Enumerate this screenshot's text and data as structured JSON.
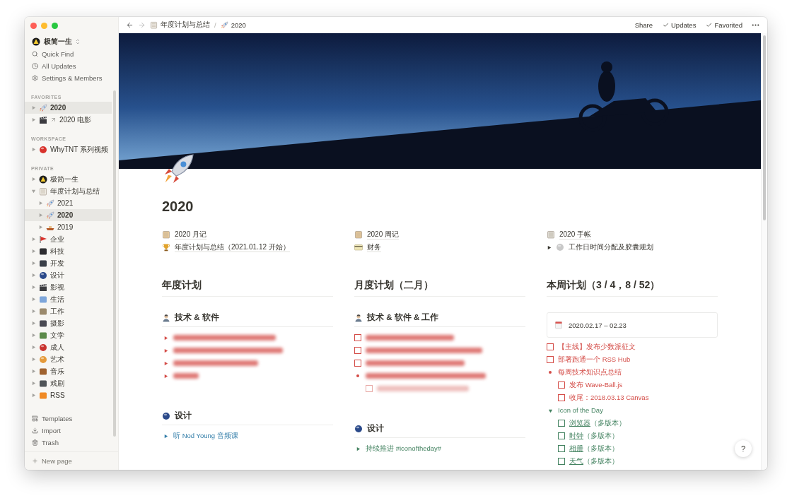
{
  "sidebar": {
    "workspace": "极简一生",
    "actions": [
      {
        "label": "Quick Find"
      },
      {
        "label": "All Updates"
      },
      {
        "label": "Settings & Members"
      }
    ],
    "sections": [
      {
        "title": "FAVORITES",
        "items": [
          {
            "label": "2020",
            "selected": true,
            "expanded": false
          },
          {
            "label": "2020 电影",
            "selected": false,
            "expanded": false,
            "link": true
          }
        ]
      },
      {
        "title": "WORKSPACE",
        "items": [
          {
            "label": "WhyTNT 系列视频",
            "selected": false,
            "expanded": false
          }
        ]
      },
      {
        "title": "PRIVATE",
        "items": [
          {
            "label": "极简一生",
            "selected": false,
            "expanded": false
          },
          {
            "label": "年度计划与总结",
            "selected": false,
            "expanded": true,
            "children": [
              {
                "label": "2021",
                "selected": false,
                "expanded": false
              },
              {
                "label": "2020",
                "selected": true,
                "expanded": false
              },
              {
                "label": "2019",
                "selected": false,
                "expanded": false
              }
            ]
          },
          {
            "label": "企业",
            "selected": false,
            "expanded": false
          },
          {
            "label": "科技",
            "selected": false,
            "expanded": false
          },
          {
            "label": "开发",
            "selected": false,
            "expanded": false
          },
          {
            "label": "设计",
            "selected": false,
            "expanded": false
          },
          {
            "label": "影视",
            "selected": false,
            "expanded": false
          },
          {
            "label": "生活",
            "selected": false,
            "expanded": false
          },
          {
            "label": "工作",
            "selected": false,
            "expanded": false
          },
          {
            "label": "摄影",
            "selected": false,
            "expanded": false
          },
          {
            "label": "文学",
            "selected": false,
            "expanded": false
          },
          {
            "label": "成人",
            "selected": false,
            "expanded": false
          },
          {
            "label": "艺术",
            "selected": false,
            "expanded": false
          },
          {
            "label": "音乐",
            "selected": false,
            "expanded": false
          },
          {
            "label": "戏剧",
            "selected": false,
            "expanded": false
          },
          {
            "label": "RSS",
            "selected": false,
            "expanded": false
          }
        ]
      }
    ],
    "footer": [
      {
        "label": "Templates"
      },
      {
        "label": "Import"
      },
      {
        "label": "Trash"
      }
    ],
    "new_page": "New page"
  },
  "topbar": {
    "breadcrumbs": [
      {
        "label": "年度计划与总结"
      },
      {
        "label": "2020"
      }
    ],
    "separator": "/",
    "actions": [
      {
        "label": "Share",
        "checked": false
      },
      {
        "label": "Updates",
        "checked": true
      },
      {
        "label": "Favorited",
        "checked": true
      }
    ]
  },
  "page": {
    "title": "2020",
    "links": [
      [
        {
          "kind": "page",
          "text": "2020 月记"
        },
        {
          "kind": "page",
          "text": "年度计划与总结（2021.01.12 开始）"
        }
      ],
      [
        {
          "kind": "page",
          "text": "2020 周记"
        },
        {
          "kind": "page",
          "text": "财务"
        }
      ],
      [
        {
          "kind": "page",
          "text": "2020 手帐"
        },
        {
          "kind": "toggle",
          "text": "工作日时间分配及胶囊规划",
          "expanded": false
        }
      ]
    ],
    "columns": [
      {
        "heading": "年度计划",
        "sections": [
          {
            "title": "技术 & 软件",
            "blocks": [
              {
                "kind": "toggle",
                "blurred": true,
                "expanded": false,
                "color": "#d44c47"
              },
              {
                "kind": "toggle",
                "blurred": true,
                "expanded": false,
                "color": "#d44c47"
              },
              {
                "kind": "toggle",
                "blurred": true,
                "expanded": false,
                "color": "#d44c47"
              },
              {
                "kind": "toggle",
                "blurred": true,
                "expanded": false,
                "color": "#d44c47"
              }
            ]
          },
          {
            "title": "设计",
            "blocks": [
              {
                "kind": "toggle",
                "text": "听 Nod Young 音频课",
                "expanded": false,
                "color": "#337ea9"
              }
            ]
          }
        ]
      },
      {
        "heading": "月度计划（二月）",
        "sections": [
          {
            "title": "技术 & 软件 & 工作",
            "blocks": [
              {
                "kind": "todo",
                "blurred": true,
                "checked": false,
                "color": "#d44c47"
              },
              {
                "kind": "todo",
                "blurred": true,
                "checked": false,
                "color": "#d44c47"
              },
              {
                "kind": "todo",
                "blurred": true,
                "checked": false,
                "color": "#d44c47"
              },
              {
                "kind": "bullet",
                "blurred": true,
                "color": "#d44c47",
                "children": [
                  {
                    "kind": "todo",
                    "blurred": true,
                    "checked": false,
                    "color": "#e8a9a6"
                  }
                ]
              }
            ]
          },
          {
            "title": "设计",
            "blocks": [
              {
                "kind": "toggle",
                "text": "持续推进 #iconoftheday#",
                "expanded": false,
                "color": "#448361"
              }
            ]
          }
        ]
      },
      {
        "heading": "本周计划（3 / 4，8 / 52）",
        "sections": [
          {
            "callout": "2020.02.17 – 02.23",
            "blocks": [
              {
                "kind": "todo",
                "text": "【主线】发布少数派征文",
                "checked": false,
                "color": "#d44c47"
              },
              {
                "kind": "todo",
                "text": "部署跑通一个 RSS Hub",
                "checked": false,
                "color": "#d44c47"
              },
              {
                "kind": "bullet",
                "text": "每周技术知识点总结",
                "color": "#d44c47",
                "children": [
                  {
                    "kind": "todo",
                    "text": "发布 Wave-Ball.js",
                    "checked": false,
                    "color": "#d44c47"
                  },
                  {
                    "kind": "todo",
                    "text": "收尾：2018.03.13 Canvas",
                    "checked": false,
                    "color": "#d44c47"
                  }
                ]
              },
              {
                "kind": "toggle",
                "text": "Icon of the Day",
                "expanded": true,
                "color": "#448361",
                "children": [
                  {
                    "kind": "todo",
                    "link": "浏览器",
                    "text": "（多版本）",
                    "checked": false,
                    "color": "#448361"
                  },
                  {
                    "kind": "todo",
                    "link": "时钟",
                    "text": "（多版本）",
                    "checked": false,
                    "color": "#448361"
                  },
                  {
                    "kind": "todo",
                    "link": "相册",
                    "text": "（多版本）",
                    "checked": false,
                    "color": "#448361"
                  },
                  {
                    "kind": "todo",
                    "link": "天气",
                    "text": "（多版本）",
                    "checked": false,
                    "color": "#448361"
                  }
                ]
              }
            ]
          }
        ]
      }
    ]
  },
  "help": "?"
}
